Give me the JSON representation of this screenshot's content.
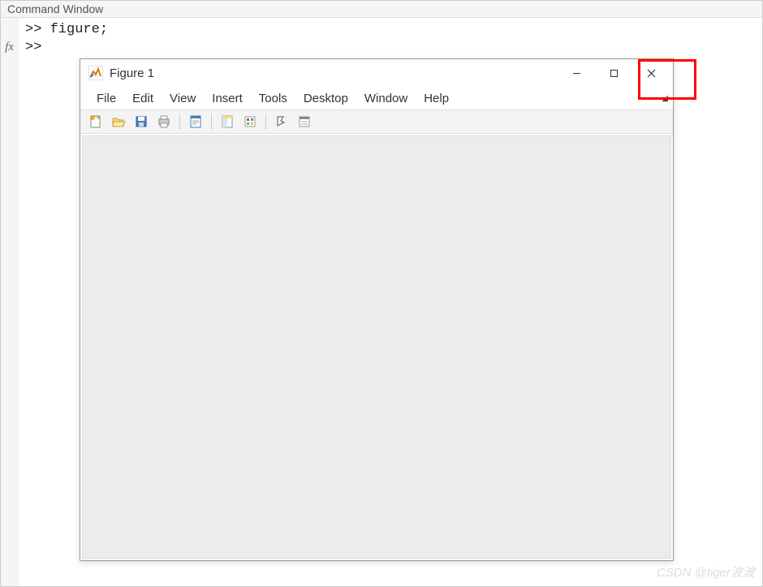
{
  "command_window": {
    "title": "Command Window",
    "gutter_label": "fx",
    "lines": [
      ">> figure;",
      ">> "
    ]
  },
  "figure_window": {
    "title": "Figure 1",
    "menu": {
      "file": "File",
      "edit": "Edit",
      "view": "View",
      "insert": "Insert",
      "tools": "Tools",
      "desktop": "Desktop",
      "window": "Window",
      "help": "Help"
    },
    "toolbar": {
      "new": "new-figure",
      "open": "open",
      "save": "save",
      "print": "print",
      "print_preview": "print-preview",
      "data_cursor": "data-cursor",
      "colorbar": "insert-colorbar",
      "cursor": "edit-plot",
      "legend": "insert-legend"
    },
    "window_controls": {
      "minimize": "−",
      "maximize": "□",
      "close": "✕"
    }
  },
  "watermark": "CSDN @tiger波波"
}
